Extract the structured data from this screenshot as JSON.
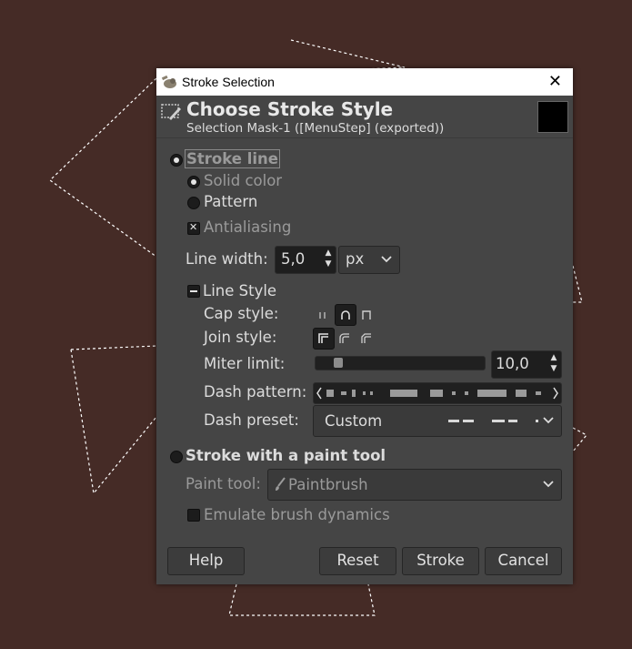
{
  "dialog": {
    "window_title": "Stroke Selection",
    "close_glyph": "✕",
    "heading": "Choose Stroke Style",
    "subheading": "Selection Mask-1 ([MenuStep] (exported))",
    "stroke_color": "#000000"
  },
  "stroke_line": {
    "label": "Stroke line",
    "solid_color": "Solid color",
    "pattern": "Pattern",
    "antialiasing": "Antialiasing",
    "line_width_label": "Line width:",
    "line_width_value": "5,0",
    "unit": "px"
  },
  "line_style": {
    "label": "Line Style",
    "cap_label": "Cap style:",
    "join_label": "Join style:",
    "miter_label": "Miter limit:",
    "miter_value": "10,0",
    "miter_fraction": 0.1,
    "dash_pattern_label": "Dash pattern:",
    "dash_preset_label": "Dash preset:",
    "dash_preset_value": "Custom"
  },
  "paint_tool": {
    "label": "Stroke with a paint tool",
    "tool_label": "Paint tool:",
    "tool_value": "Paintbrush",
    "emulate": "Emulate brush dynamics"
  },
  "buttons": {
    "help": "Help",
    "reset": "Reset",
    "stroke": "Stroke",
    "cancel": "Cancel"
  },
  "colors": {
    "canvas": "#452b26",
    "dialog": "#454545"
  }
}
